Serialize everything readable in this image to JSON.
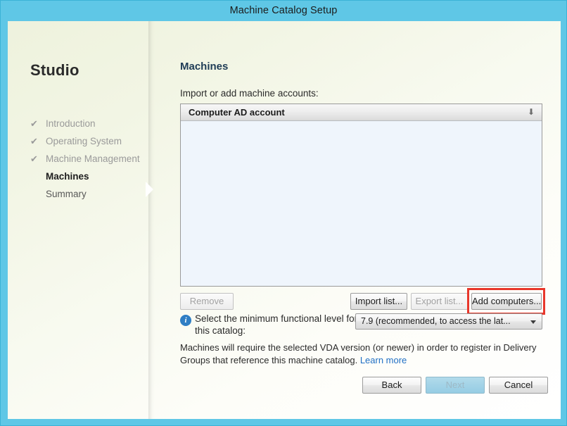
{
  "window": {
    "title": "Machine Catalog Setup",
    "frame_color": "#5fc7e6"
  },
  "sidebar": {
    "brand": "Studio",
    "items": [
      {
        "label": "Introduction",
        "state": "done",
        "tick": "✔"
      },
      {
        "label": "Operating System",
        "state": "done",
        "tick": "✔"
      },
      {
        "label": "Machine Management",
        "state": "done",
        "tick": "✔"
      },
      {
        "label": "Machines",
        "state": "current",
        "tick": ""
      },
      {
        "label": "Summary",
        "state": "pending",
        "tick": ""
      }
    ]
  },
  "main": {
    "page_title": "Machines",
    "section_label": "Import or add machine accounts:",
    "list": {
      "column_header": "Computer AD account",
      "sort_arrow": "⬇",
      "rows": [],
      "empty": true,
      "body_color": "#eff5fc"
    },
    "list_buttons": {
      "remove": "Remove",
      "remove_enabled": false,
      "import_list": "Import list...",
      "import_enabled": true,
      "export_list": "Export list...",
      "export_enabled": false,
      "add_computers": "Add computers...",
      "add_enabled": true,
      "highlight_color": "#e8372b"
    },
    "functional_level": {
      "info_icon": "info-icon",
      "icon_glyph": "i",
      "label": "Select the minimum functional level for this catalog:",
      "selected_value": "7.9 (recommended, to access the lat...",
      "options": [
        "7.9 (recommended, to access the lat..."
      ]
    },
    "note": {
      "text": "Machines will require the selected VDA version (or newer) in order to register in Delivery Groups that reference this machine catalog. ",
      "link_text": "Learn more",
      "link_color": "#1f6fc4"
    }
  },
  "footer": {
    "back": "Back",
    "next": "Next",
    "next_enabled": false,
    "cancel": "Cancel"
  }
}
